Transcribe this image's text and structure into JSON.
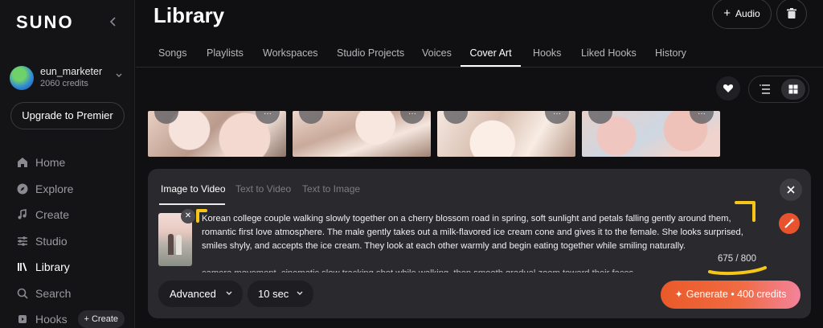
{
  "brand": {
    "logo_text": "SUNO"
  },
  "user": {
    "name": "eun_marketer",
    "credits": "2060 credits"
  },
  "sidebar": {
    "upgrade_label": "Upgrade to Premier",
    "items": [
      {
        "label": "Home",
        "icon": "home-icon"
      },
      {
        "label": "Explore",
        "icon": "compass-icon"
      },
      {
        "label": "Create",
        "icon": "music-note-icon"
      },
      {
        "label": "Studio",
        "icon": "sliders-icon"
      },
      {
        "label": "Library",
        "icon": "library-icon",
        "active": true
      },
      {
        "label": "Search",
        "icon": "search-icon"
      },
      {
        "label": "Hooks",
        "icon": "hooks-icon"
      }
    ],
    "hooks_create_label": "+ Create"
  },
  "header": {
    "title": "Library",
    "audio_label": "Audio"
  },
  "tabs": [
    "Songs",
    "Playlists",
    "Workspaces",
    "Studio Projects",
    "Voices",
    "Cover Art",
    "Hooks",
    "Liked Hooks",
    "History"
  ],
  "active_tab": "Cover Art",
  "panel": {
    "tabs": [
      "Image to Video",
      "Text to Video",
      "Text to Image"
    ],
    "active_tab": "Image to Video",
    "prompt": "Korean college couple walking slowly together on a cherry blossom road in spring, soft sunlight and petals falling gently around them, romantic first love atmosphere. The male gently takes out a milk-flavored ice cream cone and gives it to the female. She looks surprised, smiles shyly, and accepts the ice cream. They look at each other warmly and begin eating together while smiling naturally.",
    "prompt_next_line": "camera movement, cinematic slow tracking shot while walking, then smooth gradual zoom toward their faces",
    "char_count": "675 / 800",
    "advanced_label": "Advanced",
    "duration_label": "10 sec",
    "generate_label": "Generate • 400 credits"
  },
  "colors": {
    "accent": "#e8532e",
    "annotation": "#f5c518",
    "background": "#101012",
    "panel": "#2a2a2e"
  }
}
